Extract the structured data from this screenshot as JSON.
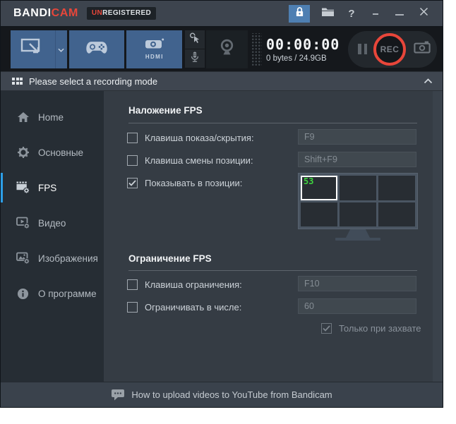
{
  "titlebar": {
    "logo_primary": "BANDI",
    "logo_accent": "CAM",
    "badge_prefix": "UN",
    "badge_rest": "REGISTERED",
    "help_label": "?"
  },
  "toolbar": {
    "hdmi_label": "HDMI",
    "timer": "00:00:00",
    "storage": "0 bytes / 24.9GB",
    "rec_label": "REC"
  },
  "mode_bar": {
    "text": "Please select a recording mode"
  },
  "sidebar": {
    "items": [
      {
        "label": "Home",
        "icon": "home-icon",
        "active": false
      },
      {
        "label": "Основные",
        "icon": "gear-icon",
        "active": false
      },
      {
        "label": "FPS",
        "icon": "fps-icon",
        "active": true
      },
      {
        "label": "Видео",
        "icon": "video-settings-icon",
        "active": false
      },
      {
        "label": "Изображения",
        "icon": "image-settings-icon",
        "active": false
      },
      {
        "label": "О программе",
        "icon": "info-icon",
        "active": false
      }
    ]
  },
  "main": {
    "overlay": {
      "title": "Наложение FPS",
      "rows": [
        {
          "label": "Клавиша показа/скрытия:",
          "value": "F9",
          "checked": false
        },
        {
          "label": "Клавиша смены позиции:",
          "value": "Shift+F9",
          "checked": false
        },
        {
          "label": "Показывать в позиции:",
          "checked": true
        }
      ],
      "position_grid": {
        "columns": 3,
        "rows": 2,
        "selected_cell": 0,
        "position_value": "53"
      }
    },
    "limit": {
      "title": "Ограничение FPS",
      "rows": [
        {
          "label": "Клавиша ограничения:",
          "value": "F10",
          "checked": false
        },
        {
          "label": "Ограничивать в числе:",
          "value": "60",
          "checked": false
        }
      ],
      "sub_label": "Только при захвате",
      "sub_checked": true,
      "sub_disabled": true
    }
  },
  "footer": {
    "text": "How to upload videos to YouTube from Bandicam"
  },
  "colors": {
    "accent_red": "#e8463a",
    "button_blue": "#41638e",
    "lock_blue": "#4e7fb2",
    "active_blue": "#2d9fe8",
    "fps_green": "#3fd43f"
  }
}
